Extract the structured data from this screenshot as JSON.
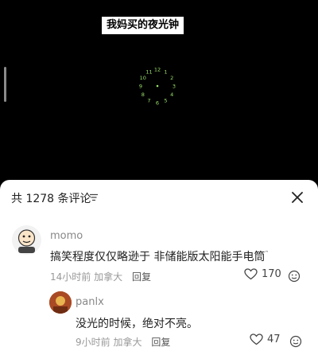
{
  "video": {
    "caption": "我妈买的夜光钟",
    "clock_numerals": [
      "12",
      "1",
      "2",
      "3",
      "4",
      "5",
      "6",
      "7",
      "8",
      "9",
      "10",
      "11"
    ]
  },
  "comments_header": {
    "title": "共 1278 条评论"
  },
  "comments": [
    {
      "username": "momo",
      "text": "搞笑程度仅仅略逊于 非储能版太阳能手电筒",
      "time": "14小时前",
      "location": "加拿大",
      "reply_label": "回复",
      "likes": "170"
    },
    {
      "username": "panlx",
      "text": "没光的时候，绝对不亮。",
      "time": "9小时前",
      "location": "加拿大",
      "reply_label": "回复",
      "likes": "47"
    }
  ],
  "colors": {
    "glow": "#9be26a",
    "sheet_bg": "#ffffff",
    "video_bg": "#000000"
  }
}
